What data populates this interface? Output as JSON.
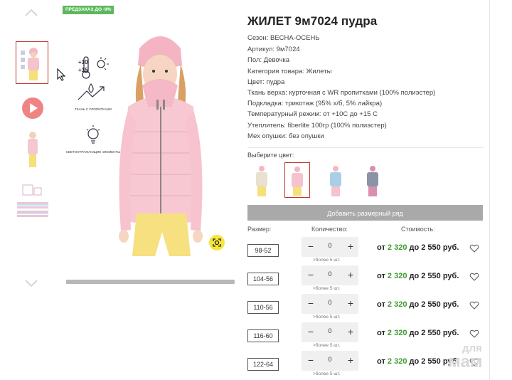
{
  "badge": "ПРЕДЗАКАЗ ДО -9%",
  "title": "ЖИЛЕТ 9м7024 пудра",
  "attributes": [
    "Сезон: ВЕСНА-ОСЕНЬ",
    "Артикул: 9м7024",
    "Пол: Девочка",
    "Категория товара: Жилеты",
    "Цвет: пудра",
    "Ткань верха: курточная с WR пропитками (100% полиэстер)",
    "Подкладка: трикотаж (95% х/б, 5% лайкра)",
    "Температурный режим: от +10С до +15 С",
    "Утеплитель: fiberlite 100гр (100% полиэстер)",
    "Мех опушки: без опушки"
  ],
  "image_features": {
    "temp_top": "+10",
    "temp_bottom": "+15",
    "fabric_label": "ТКАНЬ С ПРОПИТКАМИ",
    "reflect_label": "СВЕТООТРАЖАЮЩИЕ ЭЛЕМЕНТЫ"
  },
  "choose_color_label": "Выберите цвет:",
  "add_size_row_label": "Добавить размерный ряд",
  "headers": {
    "size": "Размер:",
    "quantity": "Количество:",
    "price": "Стоимость:"
  },
  "rows": [
    {
      "size": "98-52",
      "qty": "0",
      "more": ">более 5 шт.",
      "price_from": "от",
      "price_low": "2 320",
      "price_to": "до 2 550 руб."
    },
    {
      "size": "104-56",
      "qty": "0",
      "more": ">более 5 шт.",
      "price_from": "от",
      "price_low": "2 320",
      "price_to": "до 2 550 руб."
    },
    {
      "size": "110-56",
      "qty": "0",
      "more": ">более 5 шт.",
      "price_from": "от",
      "price_low": "2 320",
      "price_to": "до 2 550 руб."
    },
    {
      "size": "116-60",
      "qty": "0",
      "more": ">более 5 шт.",
      "price_from": "от",
      "price_low": "2 320",
      "price_to": "до 2 550 руб."
    },
    {
      "size": "122-64",
      "qty": "0",
      "more": ">более 5 шт.",
      "price_from": "от",
      "price_low": "2 320",
      "price_to": "до 2 550 руб."
    }
  ],
  "stepper": {
    "minus": "−",
    "plus": "+"
  },
  "watermark_top": "для",
  "watermark_bottom": "мам",
  "colors": {
    "accent_green": "#3e9a2f",
    "badge_green": "#5cb85c",
    "selected_border": "#c0392b",
    "button_grey": "#a9a9a9"
  }
}
